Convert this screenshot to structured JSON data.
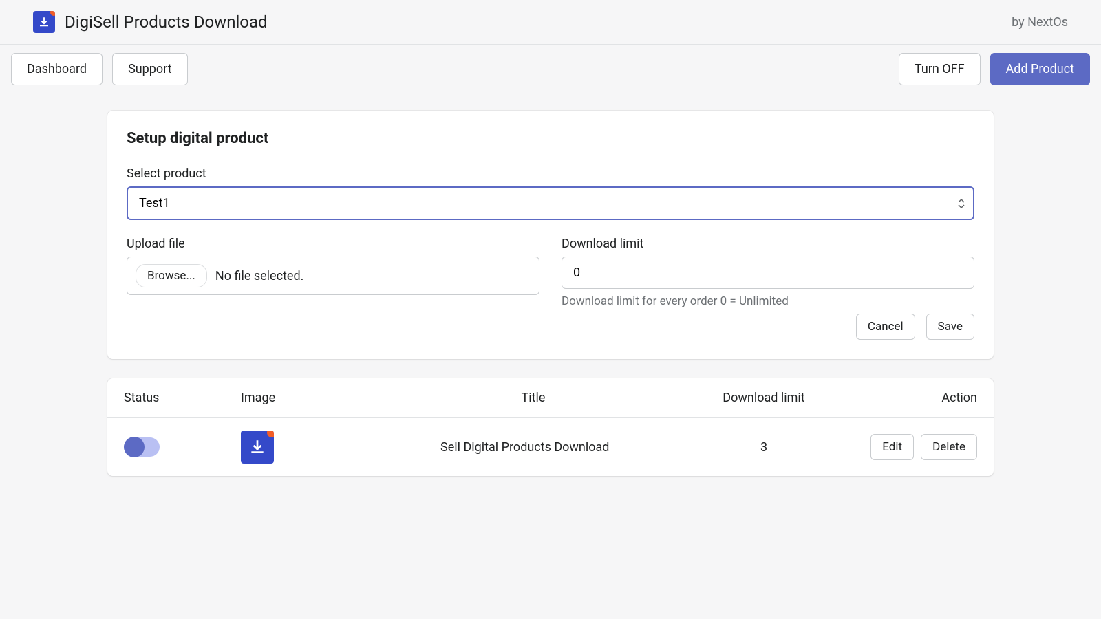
{
  "header": {
    "app_title": "DigiSell Products Download",
    "by_text": "by NextOs"
  },
  "toolbar": {
    "dashboard": "Dashboard",
    "support": "Support",
    "turn_off": "Turn OFF",
    "add_product": "Add Product"
  },
  "form": {
    "title": "Setup digital product",
    "select_product_label": "Select product",
    "select_product_value": "Test1",
    "upload_file_label": "Upload file",
    "browse_label": "Browse...",
    "file_status": "No file selected.",
    "download_limit_label": "Download limit",
    "download_limit_value": "0",
    "download_limit_help": "Download limit for every order 0 = Unlimited",
    "cancel": "Cancel",
    "save": "Save"
  },
  "table": {
    "headers": {
      "status": "Status",
      "image": "Image",
      "title": "Title",
      "limit": "Download limit",
      "action": "Action"
    },
    "rows": [
      {
        "title": "Sell Digital Products Download",
        "limit": "3",
        "edit": "Edit",
        "delete": "Delete"
      }
    ]
  }
}
